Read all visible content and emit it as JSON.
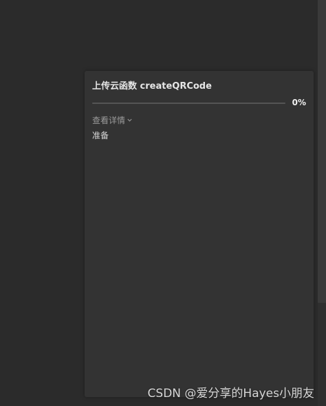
{
  "upload_panel": {
    "title": "上传云函数 createQRCode",
    "progress": {
      "fraction": 0,
      "percent_text": "0%"
    },
    "details_toggle_label": "查看详情",
    "status": "准备"
  },
  "watermark": {
    "text": "CSDN @爱分享的Hayes小朋友"
  },
  "icons": {
    "details_toggle": "chevron-down-icon"
  },
  "colors": {
    "background": "#2b2b2b",
    "panel": "#333333",
    "progress_track": "#555555"
  }
}
